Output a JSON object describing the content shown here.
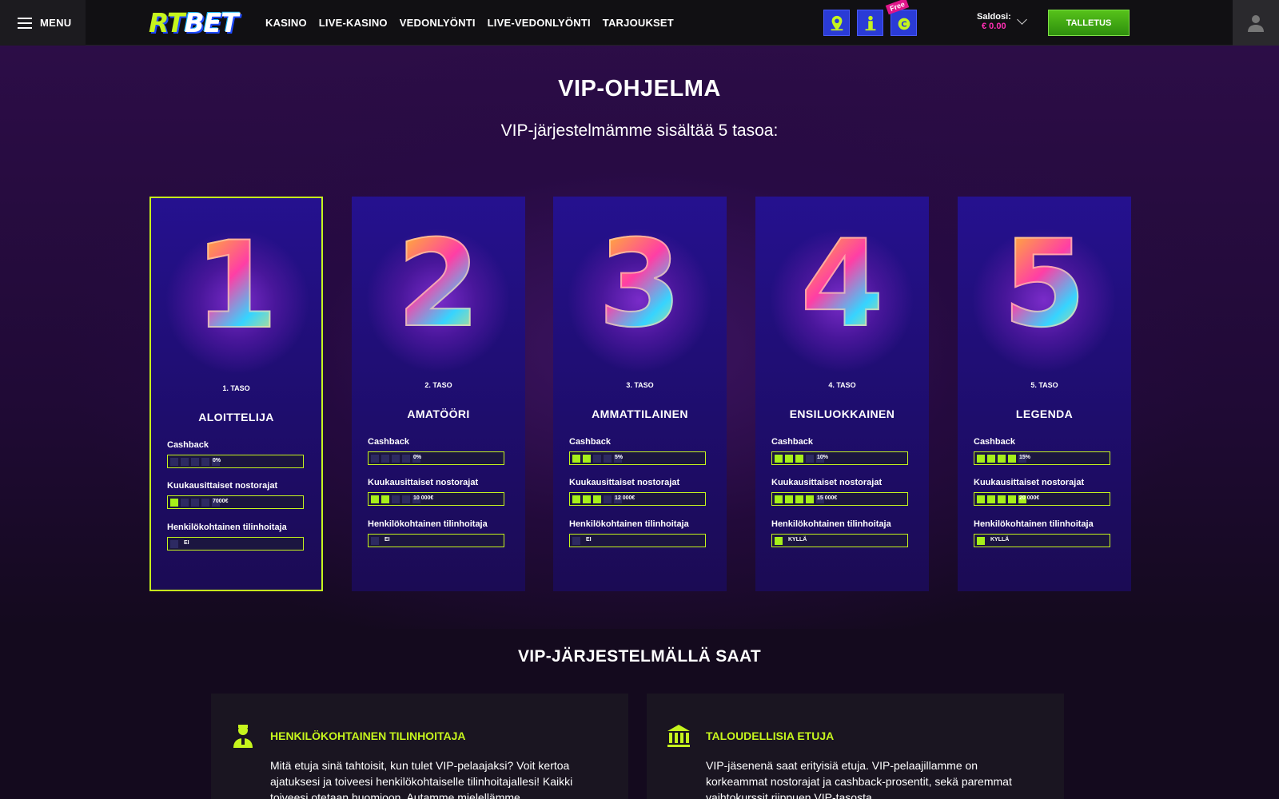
{
  "header": {
    "menu_label": "MENU",
    "logo_part1": "RT",
    "logo_part2": "BET",
    "nav": [
      "KASINO",
      "LIVE-KASINO",
      "VEDONLYÖNTI",
      "LIVE-VEDONLYÖNTI",
      "TARJOUKSET"
    ],
    "free_badge": "Free",
    "balance_label": "Saldosi:",
    "balance_amount": "€ 0.00",
    "deposit_label": "TALLETUS"
  },
  "vip": {
    "title": "VIP-OHJELMA",
    "subtitle": "VIP-järjestelmämme sisältää 5 tasoa:",
    "stat_labels": {
      "cashback": "Cashback",
      "withdrawal": "Kuukausittaiset nostorajat",
      "manager": "Henkilökohtainen tilinhoitaja"
    },
    "tiers": [
      {
        "numeral": "1",
        "label": "1. TASO",
        "name": "ALOITTELIJA",
        "cashback": "0%",
        "cashback_level": 0,
        "withdrawal": "7000€",
        "withdrawal_level": 1,
        "manager": "EI",
        "manager_on": false
      },
      {
        "numeral": "2",
        "label": "2. TASO",
        "name": "AMATÖÖRI",
        "cashback": "0%",
        "cashback_level": 0,
        "withdrawal": "10 000€",
        "withdrawal_level": 2,
        "manager": "EI",
        "manager_on": false
      },
      {
        "numeral": "3",
        "label": "3. TASO",
        "name": "AMMATTILAINEN",
        "cashback": "5%",
        "cashback_level": 2,
        "withdrawal": "12 000€",
        "withdrawal_level": 3,
        "manager": "EI",
        "manager_on": false
      },
      {
        "numeral": "4",
        "label": "4. TASO",
        "name": "ENSILUOKKAINEN",
        "cashback": "10%",
        "cashback_level": 3,
        "withdrawal": "15 000€",
        "withdrawal_level": 4,
        "manager": "KYLLÄ",
        "manager_on": true
      },
      {
        "numeral": "5",
        "label": "5. TASO",
        "name": "LEGENDA",
        "cashback": "15%",
        "cashback_level": 4,
        "withdrawal": "20 000€",
        "withdrawal_level": 5,
        "manager": "KYLLÄ",
        "manager_on": true
      }
    ]
  },
  "benefits": {
    "title": "VIP-JÄRJESTELMÄLLÄ SAAT",
    "items": [
      {
        "icon": "account-manager-icon",
        "heading": "HENKILÖKOHTAINEN TILINHOITAJA",
        "text": "Mitä etuja sinä tahtoisit, kun tulet VIP-pelaajaksi? Voit kertoa ajatuksesi ja toiveesi henkilökohtaiselle tilinhoitajallesi! Kaikki toiveesi otetaan huomioon. Autamme mielellämme"
      },
      {
        "icon": "bank-icon",
        "heading": "TALOUDELLISIA ETUJA",
        "text": "VIP-jäsenenä saat erityisiä etuja. VIP-pelaajillamme on korkeammat nostorajat ja cashback-prosentit, sekä paremmat vaihtokurssit riippuen VIP-tasosta."
      }
    ]
  },
  "colors": {
    "accent": "#c6f51d",
    "bar_fill": "#a6f01a",
    "deposit": "#3aa913",
    "balance": "#ff2fb4",
    "card_bg": "#23108a"
  }
}
